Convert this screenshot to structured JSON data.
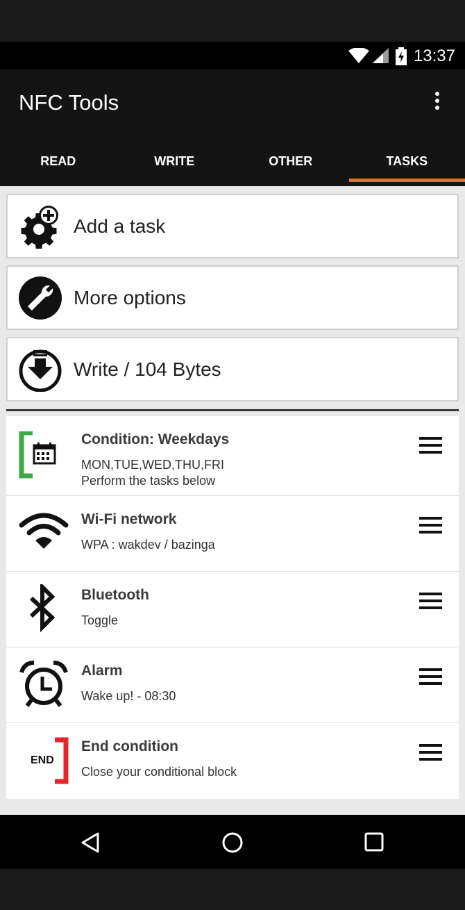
{
  "status_bar": {
    "time": "13:37"
  },
  "app_bar": {
    "title": "NFC Tools"
  },
  "tabs": [
    {
      "label": "READ"
    },
    {
      "label": "WRITE"
    },
    {
      "label": "OTHER"
    },
    {
      "label": "TASKS"
    }
  ],
  "active_tab": "TASKS",
  "actions": {
    "add_task": "Add a task",
    "more_options": "More options",
    "write": "Write / 104 Bytes"
  },
  "tasks": [
    {
      "title": "Condition: Weekdays",
      "subtitle": "MON,TUE,WED,THU,FRI",
      "subtitle2": "Perform the tasks below",
      "icon": "calendar-condition-icon"
    },
    {
      "title": "Wi-Fi network",
      "subtitle": "WPA : wakdev / bazinga",
      "icon": "wifi-icon"
    },
    {
      "title": "Bluetooth",
      "subtitle": "Toggle",
      "icon": "bluetooth-icon"
    },
    {
      "title": "Alarm",
      "subtitle": "Wake up! - 08:30",
      "icon": "alarm-clock-icon"
    },
    {
      "title": "End condition",
      "subtitle": "Close your conditional block",
      "icon": "end-condition-icon",
      "icon_text": "END"
    }
  ],
  "colors": {
    "accent": "#ef6b33",
    "condition_green": "#3daa47",
    "end_red": "#e5262b"
  }
}
